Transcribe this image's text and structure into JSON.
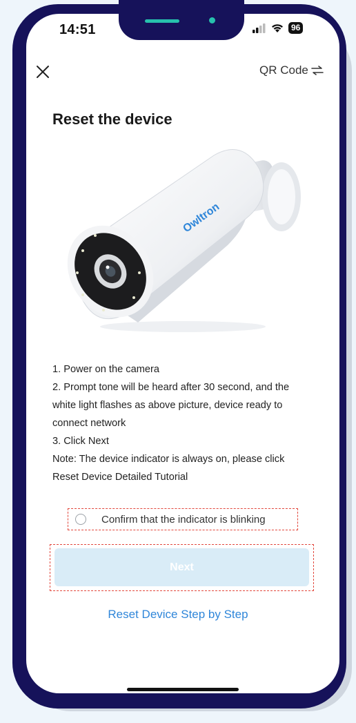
{
  "status_bar": {
    "time": "14:51",
    "battery": "96"
  },
  "header": {
    "qr_label": "QR Code"
  },
  "page": {
    "title": "Reset the device"
  },
  "camera": {
    "brand": "Owltron"
  },
  "instructions": [
    "1. Power on the camera",
    "2. Prompt tone will be heard after 30 second, and the",
    "white light flashes as above picture, device ready to",
    "connect network",
    "3. Click Next",
    "Note: The device indicator is always on, please click",
    "Reset Device Detailed Tutorial"
  ],
  "confirm": {
    "label": "Confirm that the indicator is blinking",
    "checked": false
  },
  "actions": {
    "next_label": "Next",
    "step_link": "Reset Device Step by Step"
  },
  "colors": {
    "frame": "#16125a",
    "accent": "#27c1ad",
    "link": "#2f86d9",
    "button_disabled": "#d9ecf7",
    "highlight": "#e2463b"
  }
}
